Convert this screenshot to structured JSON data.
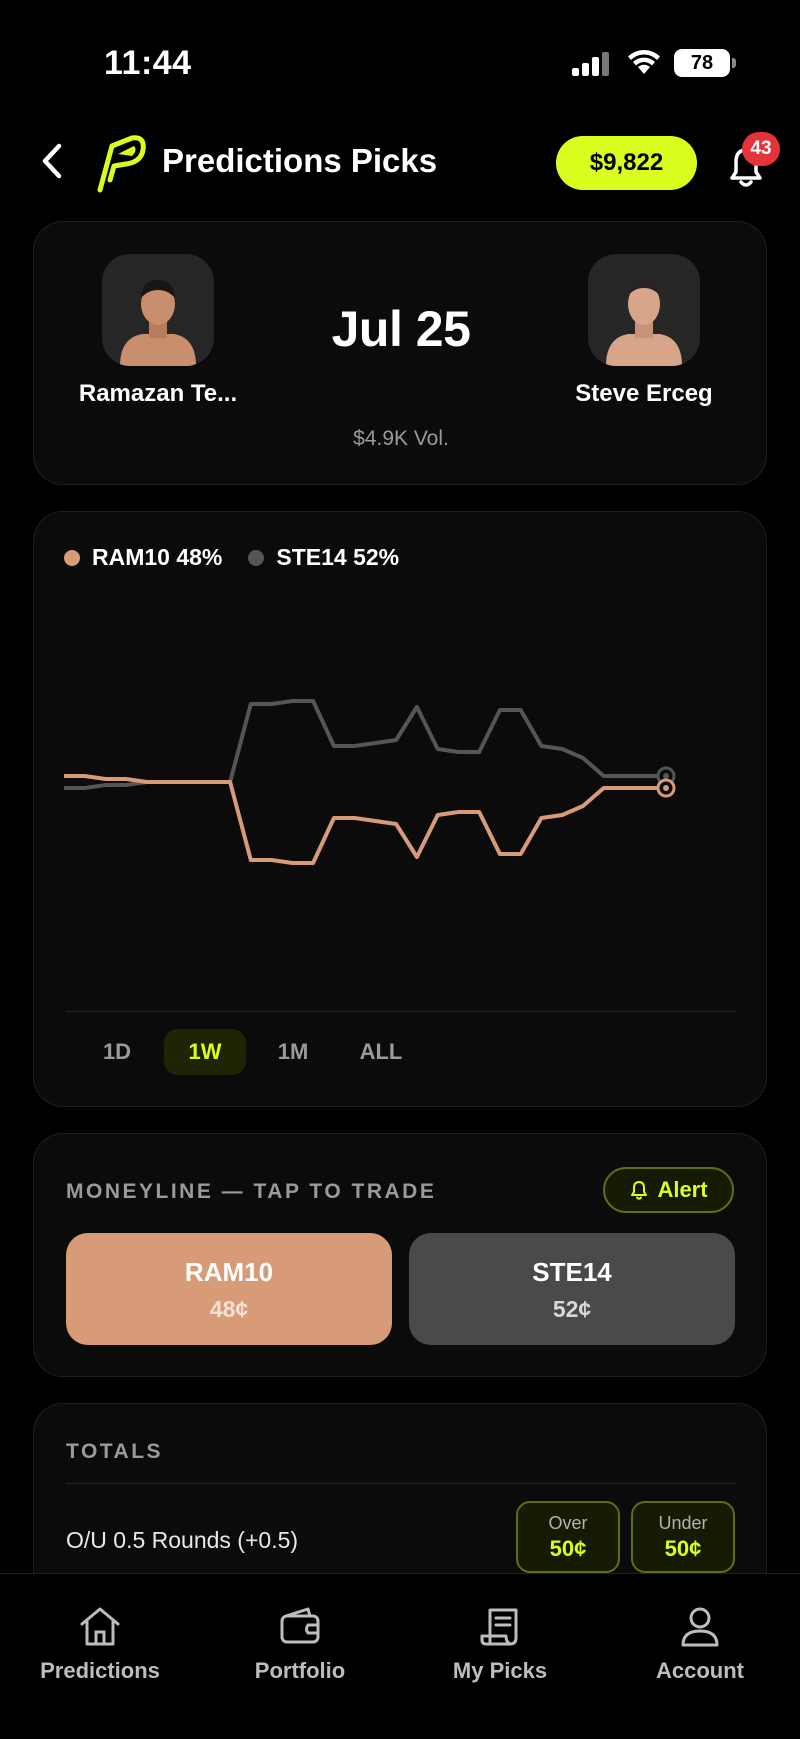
{
  "status_bar": {
    "time": "11:44",
    "battery": "78"
  },
  "header": {
    "title": "Predictions Picks",
    "balance": "$9,822",
    "notifications_count": "43"
  },
  "matchup": {
    "fighter_left": "Ramazan Te...",
    "fighter_right": "Steve Erceg",
    "date": "Jul 25",
    "volume": "$4.9K Vol."
  },
  "chart": {
    "legend": [
      {
        "label": "RAM10 48%",
        "color": "#d79b77"
      },
      {
        "label": "STE14 52%",
        "color": "#555555"
      }
    ],
    "ranges": [
      "1D",
      "1W",
      "1M",
      "ALL"
    ],
    "active_range": "1W"
  },
  "chart_data": {
    "type": "line",
    "title": "",
    "xlabel": "",
    "ylabel": "",
    "ylim": [
      0,
      100
    ],
    "series": [
      {
        "name": "RAM10",
        "color": "#d79b77",
        "values": [
          52,
          52,
          51,
          51,
          50,
          50,
          50,
          50,
          50,
          24,
          24,
          23,
          23,
          38,
          38,
          37,
          36,
          25,
          39,
          40,
          40,
          26,
          26,
          38,
          39,
          42,
          48,
          48,
          48,
          48
        ]
      },
      {
        "name": "STE14",
        "color": "#555555",
        "values": [
          48,
          48,
          49,
          49,
          50,
          50,
          50,
          50,
          50,
          76,
          76,
          77,
          77,
          62,
          62,
          63,
          64,
          75,
          61,
          60,
          60,
          74,
          74,
          62,
          61,
          58,
          52,
          52,
          52,
          52
        ]
      }
    ]
  },
  "moneyline": {
    "label": "MONEYLINE — TAP TO TRADE",
    "alert": "Alert",
    "options": [
      {
        "code": "RAM10",
        "price": "48¢"
      },
      {
        "code": "STE14",
        "price": "52¢"
      }
    ]
  },
  "totals": {
    "label": "TOTALS",
    "market": "O/U 0.5 Rounds  (+0.5)",
    "over_label": "Over",
    "over_price": "50¢",
    "under_label": "Under",
    "under_price": "50¢"
  },
  "nav": {
    "items": [
      {
        "label": "Predictions",
        "icon": "home-icon"
      },
      {
        "label": "Portfolio",
        "icon": "wallet-icon"
      },
      {
        "label": "My Picks",
        "icon": "receipt-icon"
      },
      {
        "label": "Account",
        "icon": "person-icon"
      }
    ]
  }
}
